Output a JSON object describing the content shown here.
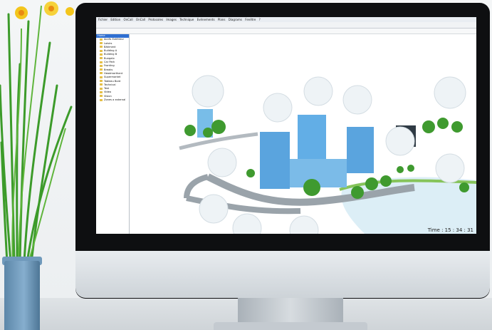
{
  "app": {
    "menu": [
      "Fichier",
      "Edition",
      "OnCall",
      "OnCall",
      "Protocoles",
      "Images",
      "Technique",
      "Evénements",
      "Plans",
      "Diagrams",
      "Fenêtre",
      "?"
    ],
    "tree": {
      "root": "Home",
      "items": [
        "Accès Extérieur",
        "Loisirs",
        "Bâtiment",
        "Building A",
        "Building B",
        "Bungalo",
        "Car Park",
        "Fronting",
        "Breaks",
        "Headmarthant",
        "Supermarket",
        "Tableau Bord",
        "Technical",
        "Test",
        "Video",
        "Vision",
        "Zones a external"
      ]
    },
    "status": {
      "time_label": "Time : 15 : 34 : 31"
    }
  },
  "colors": {
    "accent": "#2f6fd1",
    "monitor_bezel": "#0e0f11",
    "pot": "#6f99bb",
    "leaf": "#3c9b2a",
    "flower": "#f3c51c"
  }
}
